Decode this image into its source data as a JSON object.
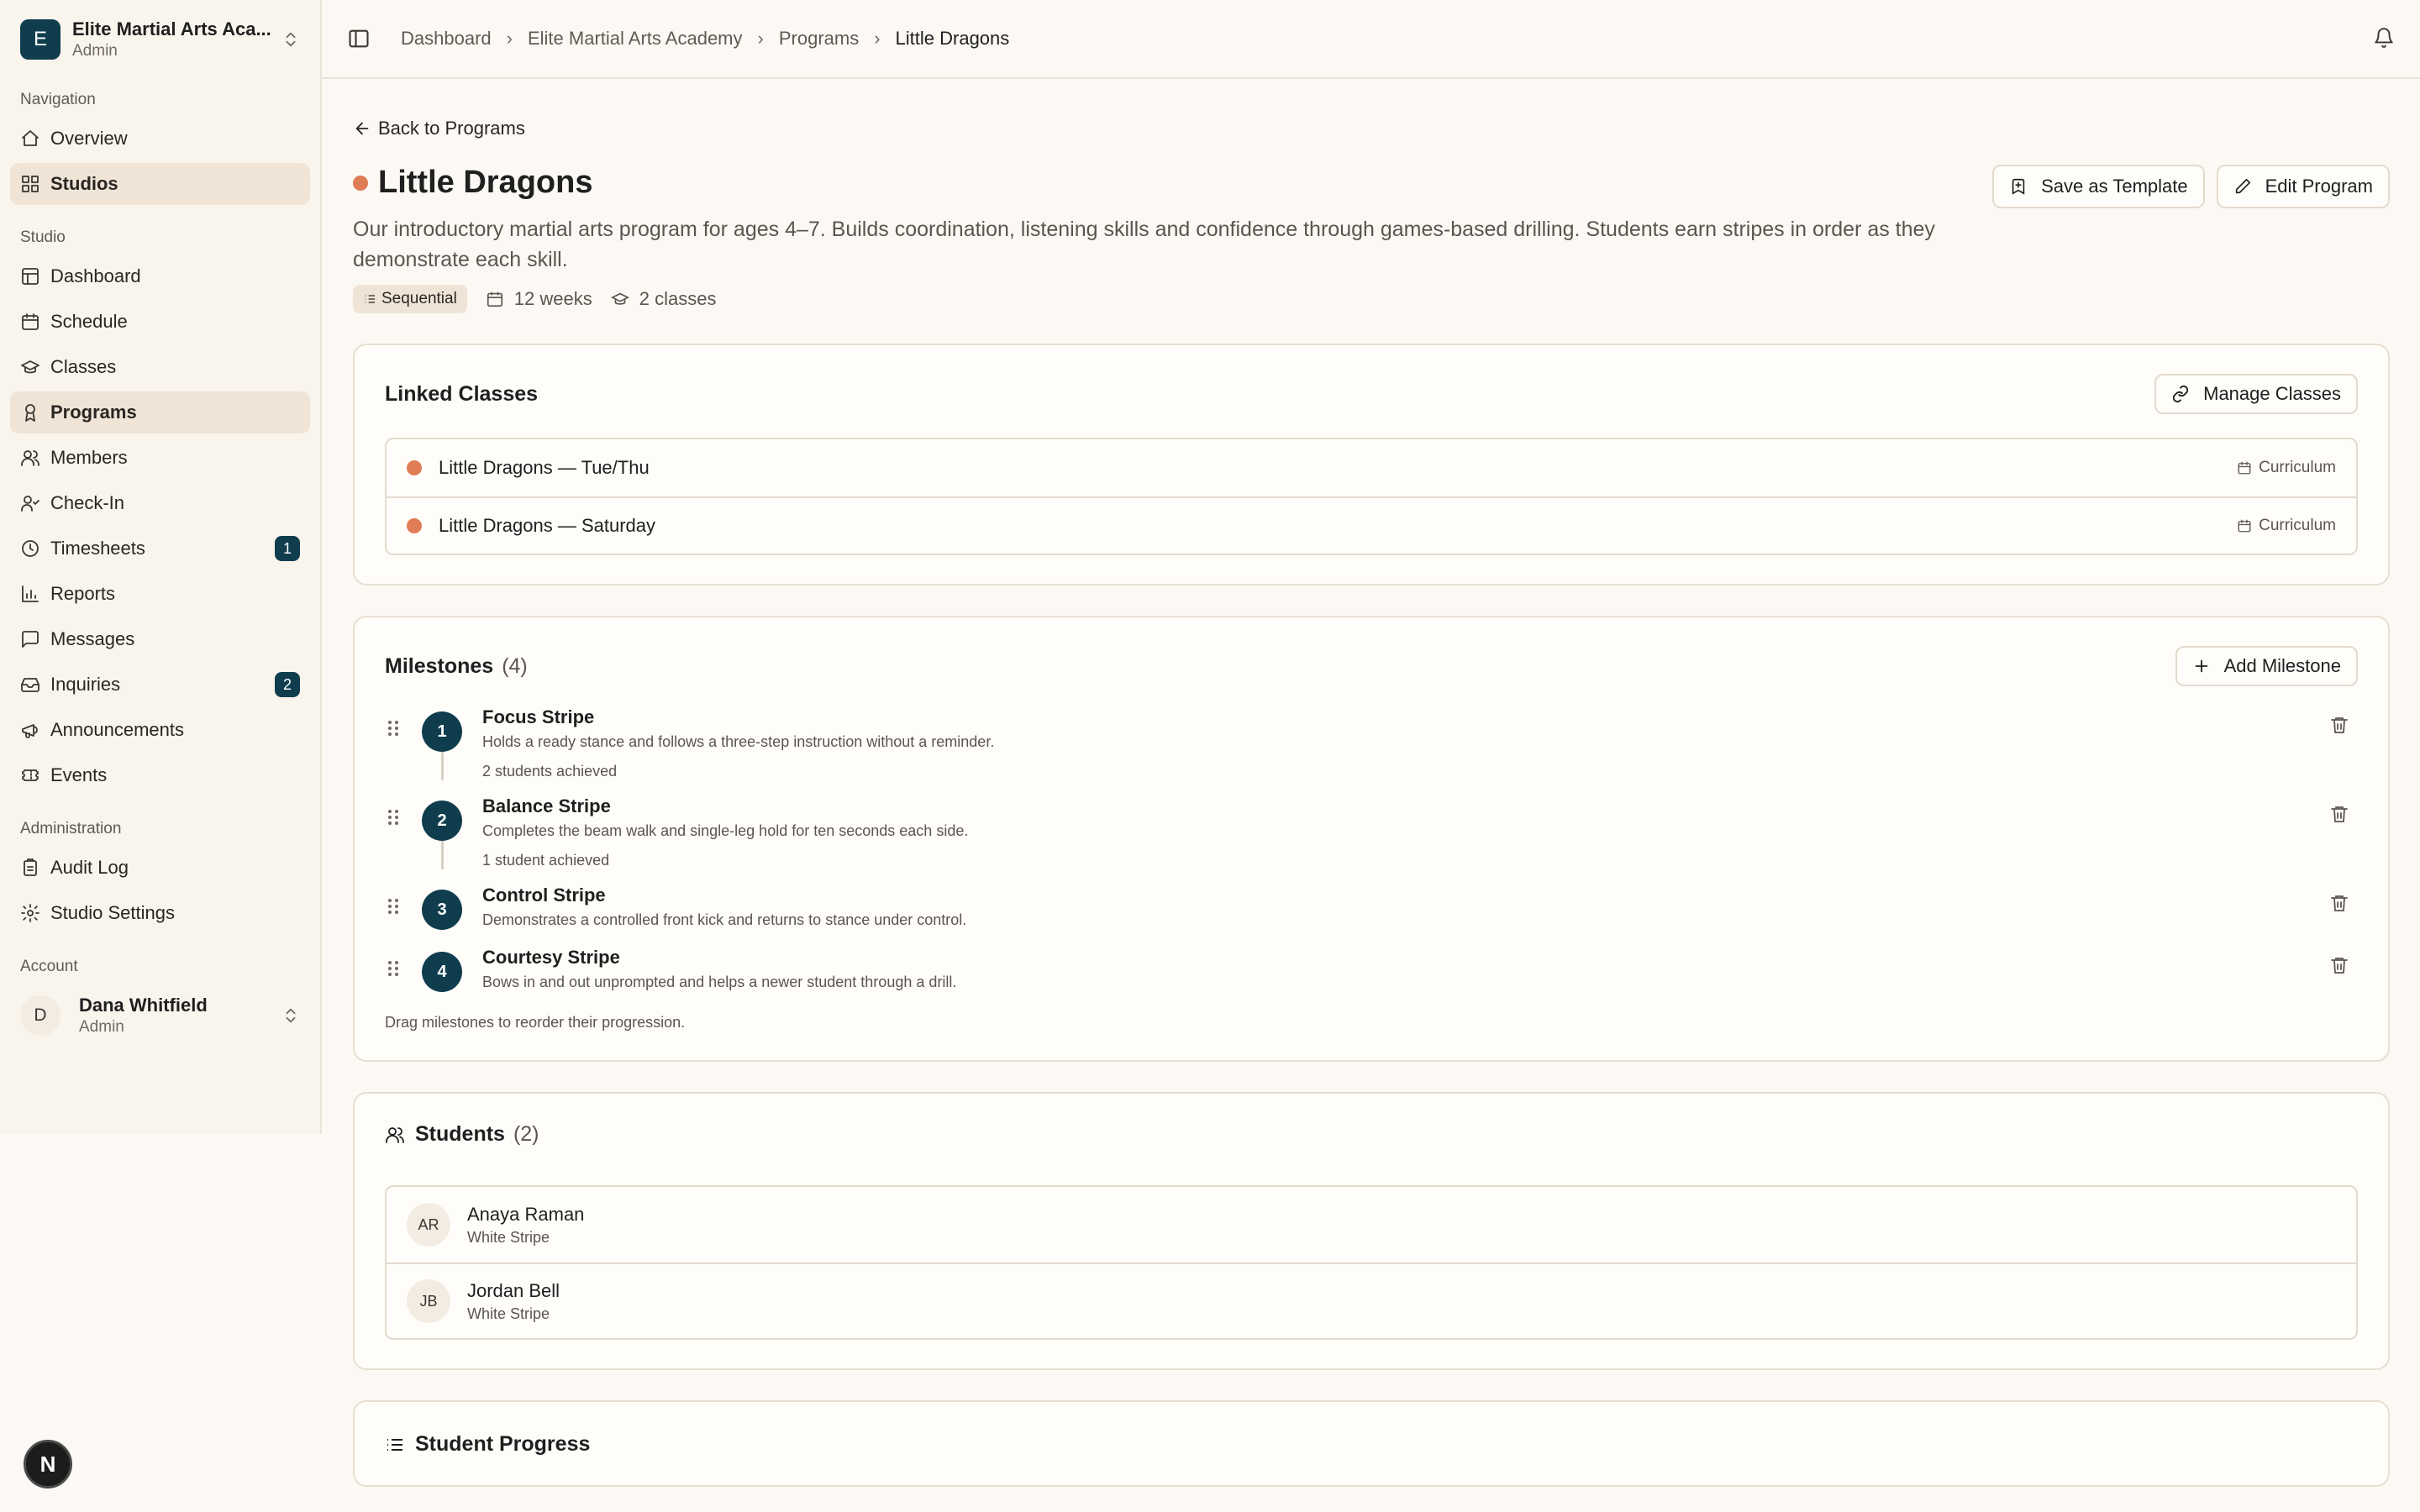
{
  "sidebar": {
    "org": {
      "initial": "E",
      "name": "Elite Martial Arts Aca...",
      "role": "Admin"
    },
    "sections": [
      {
        "title": "Navigation",
        "items": [
          {
            "label": "Overview",
            "icon": "home-icon",
            "active": false
          },
          {
            "label": "Studios",
            "icon": "grid-icon",
            "active": true
          }
        ]
      },
      {
        "title": "Studio",
        "items": [
          {
            "label": "Dashboard",
            "icon": "dashboard-icon"
          },
          {
            "label": "Schedule",
            "icon": "calendar-icon"
          },
          {
            "label": "Classes",
            "icon": "graduation-cap-icon"
          },
          {
            "label": "Programs",
            "icon": "award-icon",
            "active": true
          },
          {
            "label": "Members",
            "icon": "users-icon"
          },
          {
            "label": "Check-In",
            "icon": "user-check-icon"
          },
          {
            "label": "Timesheets",
            "icon": "clock-icon",
            "badge": "1"
          },
          {
            "label": "Reports",
            "icon": "bar-chart-icon"
          },
          {
            "label": "Messages",
            "icon": "message-icon"
          },
          {
            "label": "Inquiries",
            "icon": "inbox-icon",
            "badge": "2"
          },
          {
            "label": "Announcements",
            "icon": "megaphone-icon"
          },
          {
            "label": "Events",
            "icon": "ticket-icon"
          }
        ]
      },
      {
        "title": "Administration",
        "items": [
          {
            "label": "Audit Log",
            "icon": "clipboard-icon"
          },
          {
            "label": "Studio Settings",
            "icon": "gear-icon"
          }
        ]
      }
    ],
    "account": {
      "title": "Account",
      "initial": "D",
      "name": "Dana Whitfield",
      "role": "Admin"
    },
    "dev_badge": "N"
  },
  "breadcrumbs": [
    "Dashboard",
    "Elite Martial Arts Academy",
    "Programs",
    "Little Dragons"
  ],
  "page": {
    "back_label": "Back to Programs",
    "title": "Little Dragons",
    "description": "Our introductory martial arts program for ages 4–7. Builds coordination, listening skills and confidence through games-based drilling. Students earn stripes in order as they demonstrate each skill.",
    "save_template_label": "Save as Template",
    "edit_label": "Edit Program",
    "chip": "Sequential",
    "duration": "12 weeks",
    "class_count": "2 classes",
    "accent_color": "#e07c56",
    "brand_color": "#0f3d4e"
  },
  "linked_classes": {
    "title": "Linked Classes",
    "manage_label": "Manage Classes",
    "items": [
      {
        "name": "Little Dragons — Tue/Thu",
        "tag": "Curriculum"
      },
      {
        "name": "Little Dragons — Saturday",
        "tag": "Curriculum"
      }
    ]
  },
  "milestones": {
    "title": "Milestones",
    "count": "(4)",
    "add_label": "Add Milestone",
    "items": [
      {
        "num": "1",
        "title": "Focus Stripe",
        "desc": "Holds a ready stance and follows a three-step instruction without a reminder.",
        "achieved": "2 students achieved"
      },
      {
        "num": "2",
        "title": "Balance Stripe",
        "desc": "Completes the beam walk and single-leg hold for ten seconds each side.",
        "achieved": "1 student achieved"
      },
      {
        "num": "3",
        "title": "Control Stripe",
        "desc": "Demonstrates a controlled front kick and returns to stance under control.",
        "achieved": ""
      },
      {
        "num": "4",
        "title": "Courtesy Stripe",
        "desc": "Bows in and out unprompted and helps a newer student through a drill.",
        "achieved": ""
      }
    ],
    "hint": "Drag milestones to reorder their progression."
  },
  "students": {
    "title": "Students",
    "count": "(2)",
    "items": [
      {
        "initials": "AR",
        "name": "Anaya Raman",
        "rank": "White Stripe"
      },
      {
        "initials": "JB",
        "name": "Jordan Bell",
        "rank": "White Stripe"
      }
    ]
  },
  "progress": {
    "title": "Student Progress"
  }
}
